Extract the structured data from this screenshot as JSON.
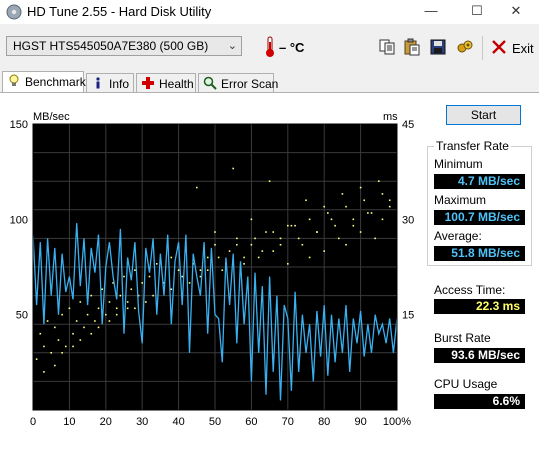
{
  "window": {
    "title": "HD Tune 2.55 - Hard Disk Utility",
    "minimize_glyph": "—",
    "maximize_glyph": "☐",
    "close_glyph": "✕"
  },
  "toolbar": {
    "drive": "HGST    HTS545050A7E380 (500 GB)",
    "temperature": "– °C",
    "exit_label": "Exit",
    "icons": [
      "copy-icon",
      "paste-icon",
      "save-icon",
      "options-icon",
      "exit-icon"
    ]
  },
  "tabs": [
    {
      "label": "Benchmark",
      "icon": "benchmark-icon",
      "active": true
    },
    {
      "label": "Info",
      "icon": "info-icon",
      "active": false
    },
    {
      "label": "Health",
      "icon": "health-icon",
      "active": false
    },
    {
      "label": "Error Scan",
      "icon": "error-scan-icon",
      "active": false
    }
  ],
  "actions": {
    "start_label": "Start"
  },
  "results": {
    "transfer_rate_title": "Transfer Rate",
    "minimum_label": "Minimum",
    "minimum_value": "4.7 MB/sec",
    "maximum_label": "Maximum",
    "maximum_value": "100.7 MB/sec",
    "average_label": "Average:",
    "average_value": "51.8 MB/sec",
    "access_time_label": "Access Time:",
    "access_time_value": "22.3 ms",
    "burst_rate_label": "Burst Rate",
    "burst_rate_value": "93.6 MB/sec",
    "cpu_usage_label": "CPU Usage",
    "cpu_usage_value": "6.6%"
  },
  "colors": {
    "transfer_line": "#3ab0f0",
    "access_dots": "#ffff80",
    "plot_background": "#000000",
    "grid": "#3a3a3a",
    "value_cyan": "#4fc3f7",
    "value_yellow": "#ffff66",
    "value_white": "#ffffff"
  },
  "chart_data": {
    "type": "line",
    "y_left_label": "MB/sec",
    "y_right_label": "ms",
    "y_left_ticks": [
      "150",
      "100",
      "50"
    ],
    "y_right_ticks": [
      "45",
      "30",
      "15"
    ],
    "x_ticks": [
      "0",
      "10",
      "20",
      "30",
      "40",
      "50",
      "60",
      "70",
      "80",
      "90",
      "100%"
    ],
    "y_left_range": [
      0,
      150
    ],
    "y_right_range": [
      0,
      45
    ],
    "x_range": [
      0,
      100
    ],
    "grid": true,
    "series": [
      {
        "axis": "left",
        "x": [
          0,
          1,
          2,
          3,
          4,
          5,
          6,
          7,
          8,
          9,
          10,
          11,
          12,
          13,
          14,
          15,
          16,
          17,
          18,
          19,
          20,
          21,
          22,
          23,
          24,
          25,
          26,
          27,
          28,
          29,
          30,
          31,
          32,
          33,
          34,
          35,
          36,
          37,
          38,
          39,
          40,
          41,
          42,
          43,
          44,
          45,
          46,
          47,
          48,
          49,
          50,
          51,
          52,
          53,
          54,
          55,
          56,
          57,
          58,
          59,
          60,
          61,
          62,
          63,
          64,
          65,
          66,
          67,
          68,
          69,
          70,
          71,
          72,
          73,
          74,
          75,
          76,
          77,
          78,
          79,
          80,
          81,
          82,
          83,
          84,
          85,
          86,
          87,
          88,
          89,
          90,
          91,
          92,
          93,
          94,
          95,
          96,
          97,
          98,
          99,
          100
        ],
        "values": [
          92,
          55,
          88,
          45,
          90,
          60,
          85,
          50,
          82,
          62,
          70,
          58,
          98,
          65,
          90,
          55,
          85,
          72,
          92,
          45,
          75,
          88,
          70,
          58,
          95,
          40,
          80,
          68,
          88,
          52,
          35,
          85,
          72,
          90,
          50,
          82,
          60,
          92,
          45,
          78,
          88,
          55,
          92,
          30,
          82,
          70,
          60,
          88,
          40,
          85,
          50,
          48,
          25,
          80,
          55,
          82,
          35,
          78,
          45,
          70,
          15,
          72,
          30,
          65,
          8,
          70,
          20,
          60,
          5,
          55,
          48,
          10,
          62,
          20,
          50,
          30,
          45,
          15,
          52,
          28,
          55,
          18,
          50,
          25,
          48,
          30,
          55,
          20,
          48,
          35,
          52,
          28,
          45,
          30,
          50,
          40,
          45,
          35,
          48,
          30,
          48
        ]
      },
      {
        "axis": "right",
        "type": "scatter",
        "x": [
          1,
          2,
          3,
          4,
          5,
          6,
          7,
          8,
          9,
          10,
          11,
          12,
          13,
          14,
          15,
          16,
          17,
          18,
          19,
          20,
          21,
          22,
          23,
          24,
          25,
          26,
          27,
          28,
          29,
          30,
          32,
          34,
          36,
          38,
          40,
          42,
          44,
          46,
          48,
          50,
          52,
          54,
          56,
          58,
          60,
          62,
          64,
          66,
          68,
          70,
          72,
          74,
          76,
          78,
          80,
          82,
          84,
          86,
          88,
          90,
          92,
          94,
          96,
          98,
          3,
          8,
          13,
          18,
          23,
          28,
          33,
          38,
          43,
          48,
          53,
          58,
          63,
          68,
          73,
          78,
          83,
          88,
          93,
          98,
          6,
          11,
          16,
          21,
          26,
          31,
          36,
          41,
          46,
          51,
          56,
          61,
          66,
          71,
          76,
          81,
          86,
          91,
          96,
          45,
          55,
          65,
          75,
          85,
          95,
          50,
          60,
          70,
          80,
          90
        ],
        "values": [
          8,
          12,
          10,
          14,
          9,
          13,
          11,
          15,
          10,
          16,
          12,
          14,
          17,
          13,
          15,
          18,
          14,
          16,
          19,
          15,
          17,
          20,
          16,
          18,
          21,
          17,
          19,
          22,
          18,
          20,
          21,
          23,
          20,
          24,
          22,
          25,
          23,
          21,
          24,
          26,
          22,
          25,
          27,
          23,
          26,
          24,
          28,
          25,
          27,
          23,
          29,
          26,
          24,
          28,
          25,
          30,
          27,
          26,
          29,
          28,
          31,
          27,
          30,
          32,
          6,
          9,
          11,
          13,
          15,
          16,
          18,
          19,
          20,
          22,
          23,
          24,
          25,
          26,
          27,
          28,
          29,
          30,
          31,
          33,
          7,
          10,
          12,
          14,
          16,
          17,
          19,
          21,
          22,
          24,
          26,
          27,
          28,
          29,
          30,
          31,
          32,
          33,
          34,
          35,
          38,
          36,
          33,
          34,
          36,
          28,
          30,
          29,
          32,
          35
        ]
      }
    ]
  }
}
